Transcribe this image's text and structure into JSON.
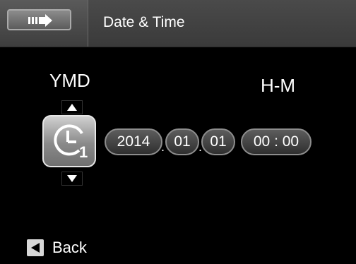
{
  "header": {
    "title": "Date & Time",
    "back_tab_icon": "back-arrow-icon"
  },
  "format": {
    "date_label": "YMD",
    "time_label": "H-M"
  },
  "date_time": {
    "year": "2014",
    "month": "01",
    "day": "01",
    "time": "00 : 00",
    "separator": "."
  },
  "icons": {
    "clock": "clock-icon",
    "up": "up-arrow-icon",
    "down": "down-arrow-icon"
  },
  "footer": {
    "back_label": "Back"
  }
}
